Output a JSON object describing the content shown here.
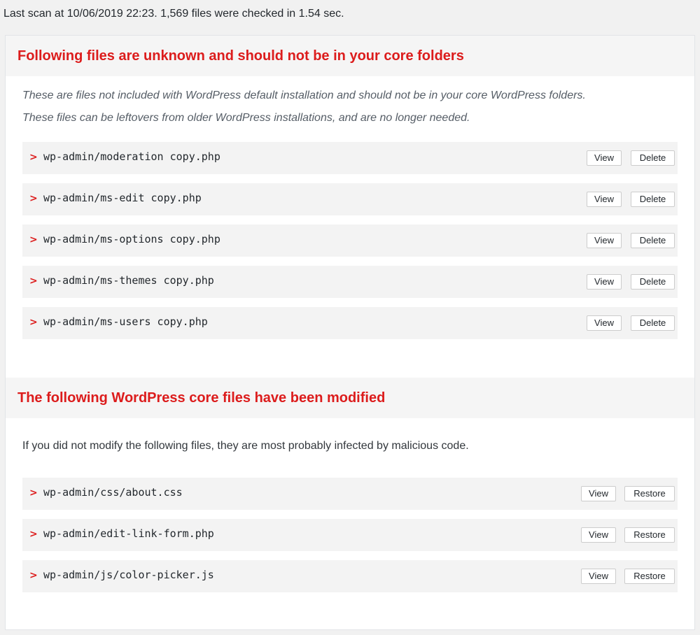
{
  "scan_status": "Last scan at 10/06/2019 22:23. 1,569 files were checked in 1.54 sec.",
  "unknown_section": {
    "title": "Following files are unknown and should not be in your core folders",
    "description_1": "These are files not included with WordPress default installation and should not be in your core WordPress folders.",
    "description_2": "These files can be leftovers from older WordPress installations, and are no longer needed.",
    "files": [
      {
        "path": "wp-admin/moderation copy.php",
        "view_label": "View",
        "action_label": "Delete"
      },
      {
        "path": "wp-admin/ms-edit copy.php",
        "view_label": "View",
        "action_label": "Delete"
      },
      {
        "path": "wp-admin/ms-options copy.php",
        "view_label": "View",
        "action_label": "Delete"
      },
      {
        "path": "wp-admin/ms-themes copy.php",
        "view_label": "View",
        "action_label": "Delete"
      },
      {
        "path": "wp-admin/ms-users copy.php",
        "view_label": "View",
        "action_label": "Delete"
      }
    ]
  },
  "modified_section": {
    "title": "The following WordPress core files have been modified",
    "description": "If you did not modify the following files, they are most probably infected by malicious code.",
    "files": [
      {
        "path": "wp-admin/css/about.css",
        "view_label": "View",
        "action_label": "Restore"
      },
      {
        "path": "wp-admin/edit-link-form.php",
        "view_label": "View",
        "action_label": "Restore"
      },
      {
        "path": "wp-admin/js/color-picker.js",
        "view_label": "View",
        "action_label": "Restore"
      }
    ]
  },
  "icons": {
    "row_expand": "chevron-right-icon"
  },
  "colors": {
    "title_red": "#dc1c1c",
    "chevron_red": "#dc1c1c",
    "row_bg": "#f3f3f3"
  }
}
